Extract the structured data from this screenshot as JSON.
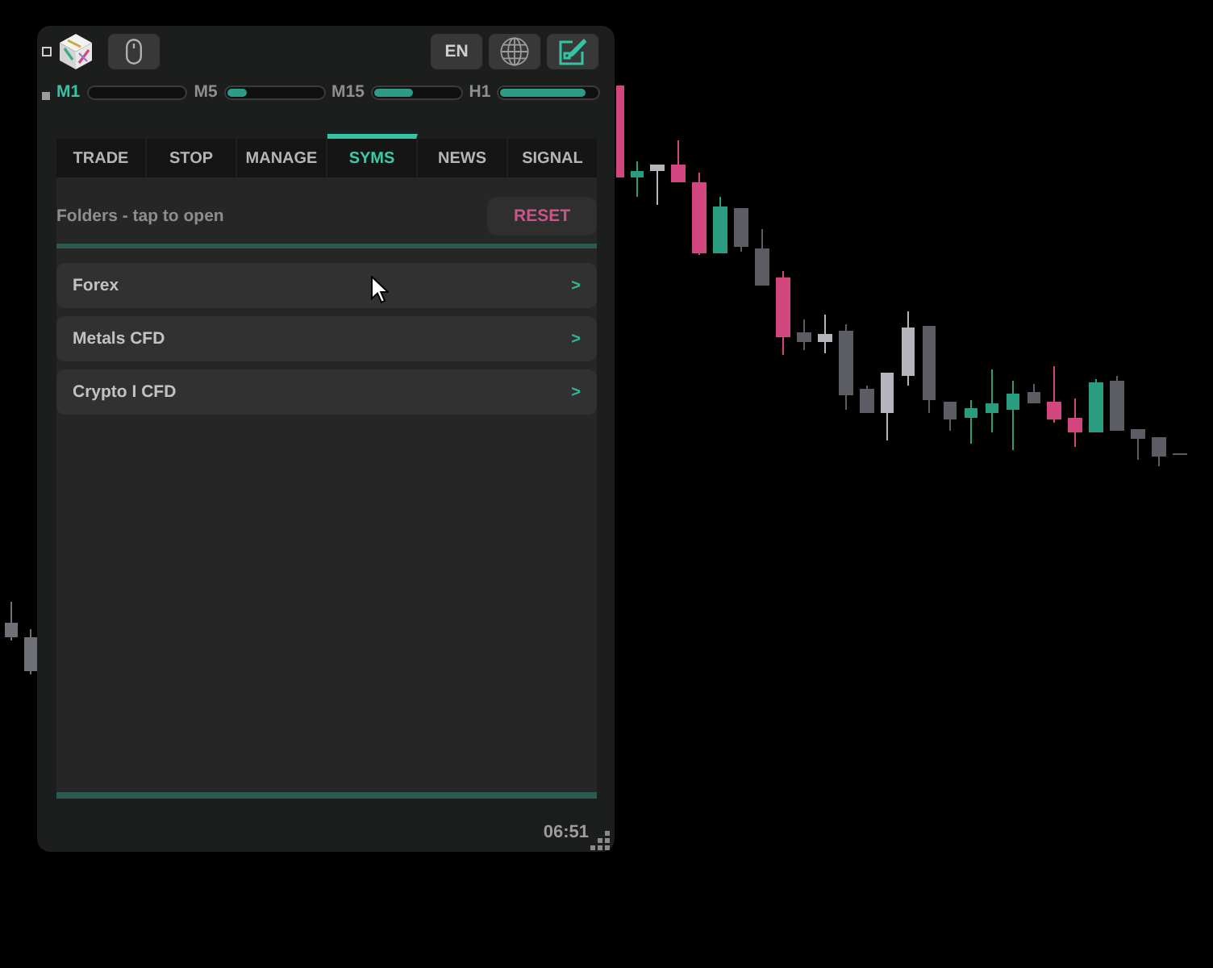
{
  "header": {
    "language": "EN"
  },
  "timeframes": [
    {
      "label": "M1",
      "selected": true
    },
    {
      "label": "M5",
      "selected": false,
      "level": 0.2
    },
    {
      "label": "M15",
      "selected": false,
      "level": 0.45
    },
    {
      "label": "H1",
      "selected": false,
      "level": 0.88
    }
  ],
  "tabs": [
    {
      "label": "TRADE",
      "selected": false
    },
    {
      "label": "STOP",
      "selected": false
    },
    {
      "label": "MANAGE",
      "selected": false
    },
    {
      "label": "SYMS",
      "selected": true
    },
    {
      "label": "NEWS",
      "selected": false
    },
    {
      "label": "SIGNAL",
      "selected": false
    }
  ],
  "folders_panel": {
    "hint": "Folders - tap to open",
    "reset_label": "RESET",
    "folders": [
      {
        "name": "Forex",
        "arrow": ">"
      },
      {
        "name": "Metals CFD",
        "arrow": ">"
      },
      {
        "name": "Crypto I CFD",
        "arrow": ">"
      }
    ]
  },
  "clock": "06:51"
}
